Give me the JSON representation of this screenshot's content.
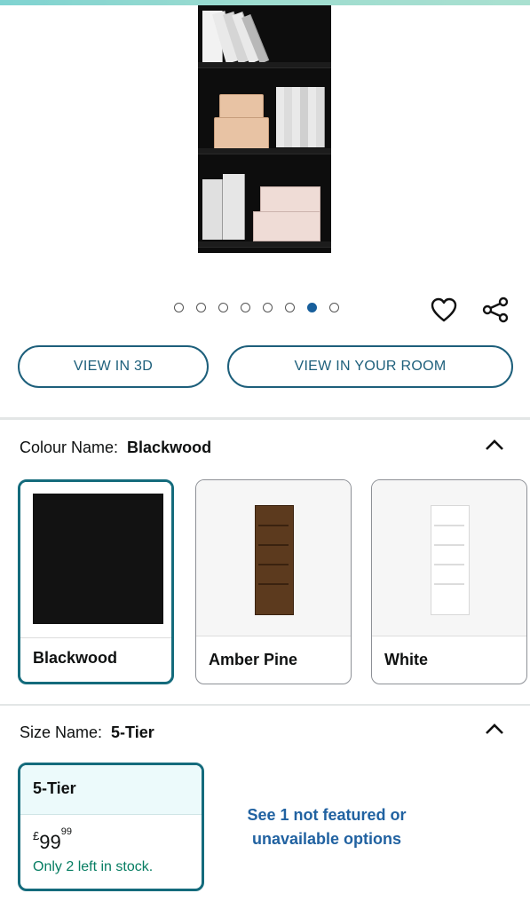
{
  "carousel": {
    "total": 8,
    "active_index": 6
  },
  "actions": {
    "view_3d_label": "VIEW IN 3D",
    "view_room_label": "VIEW IN YOUR ROOM"
  },
  "colour": {
    "label": "Colour Name:",
    "selected": "Blackwood",
    "options": [
      {
        "name": "Blackwood",
        "selected": true
      },
      {
        "name": "Amber Pine",
        "selected": false
      },
      {
        "name": "White",
        "selected": false
      }
    ]
  },
  "size": {
    "label": "Size Name:",
    "selected": "5-Tier",
    "option": {
      "name": "5-Tier",
      "currency": "£",
      "price_whole": "99",
      "price_fraction": "99",
      "stock": "Only 2 left in stock."
    },
    "see_more": "See 1 not featured or unavailable options"
  },
  "colors": {
    "accent": "#146b7c",
    "link": "#2162a1",
    "stock": "#067d62",
    "dot_active": "#185f9c"
  }
}
